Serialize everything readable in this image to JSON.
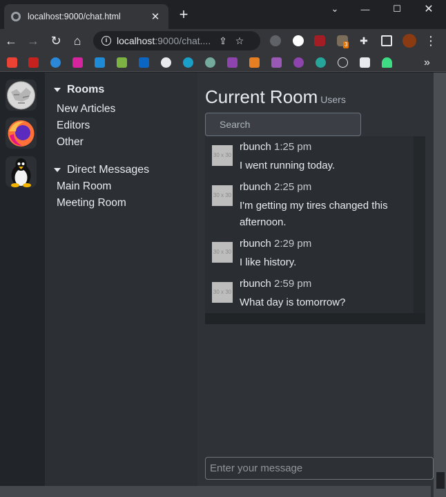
{
  "browser": {
    "tab_title": "localhost:9000/chat.html",
    "url_host": "localhost",
    "url_path": ":9000/chat....",
    "extension_badge": "3",
    "colors": {
      "frame": "#202124",
      "toolbar": "#35363a"
    },
    "icons": [
      "back-icon",
      "forward-icon",
      "reload-icon",
      "home-icon",
      "info-icon",
      "share-icon",
      "star-icon",
      "menu-icon"
    ]
  },
  "apps": [
    "wikipedia-icon",
    "firefox-icon",
    "linux-tux-icon"
  ],
  "sidebar": {
    "rooms_header": "Rooms",
    "rooms": [
      {
        "label": "New Articles"
      },
      {
        "label": "Editors"
      },
      {
        "label": "Other"
      }
    ],
    "dm_header": "Direct Messages",
    "direct_messages": [
      {
        "label": "Main Room"
      },
      {
        "label": "Meeting Room"
      }
    ]
  },
  "main": {
    "title": "Current Room",
    "subtitle": "Users",
    "search_placeholder": "Search",
    "avatar_placeholder": "30 x 30",
    "messages": [
      {
        "user": "rbunch",
        "time": "1:25 pm",
        "text": "I went running today."
      },
      {
        "user": "rbunch",
        "time": "2:25 pm",
        "text": "I'm getting my tires changed this afternoon."
      },
      {
        "user": "rbunch",
        "time": "2:29 pm",
        "text": "I like history."
      },
      {
        "user": "rbunch",
        "time": "2:59 pm",
        "text": "What day is tomorrow?"
      }
    ],
    "composer_placeholder": "Enter your message"
  }
}
